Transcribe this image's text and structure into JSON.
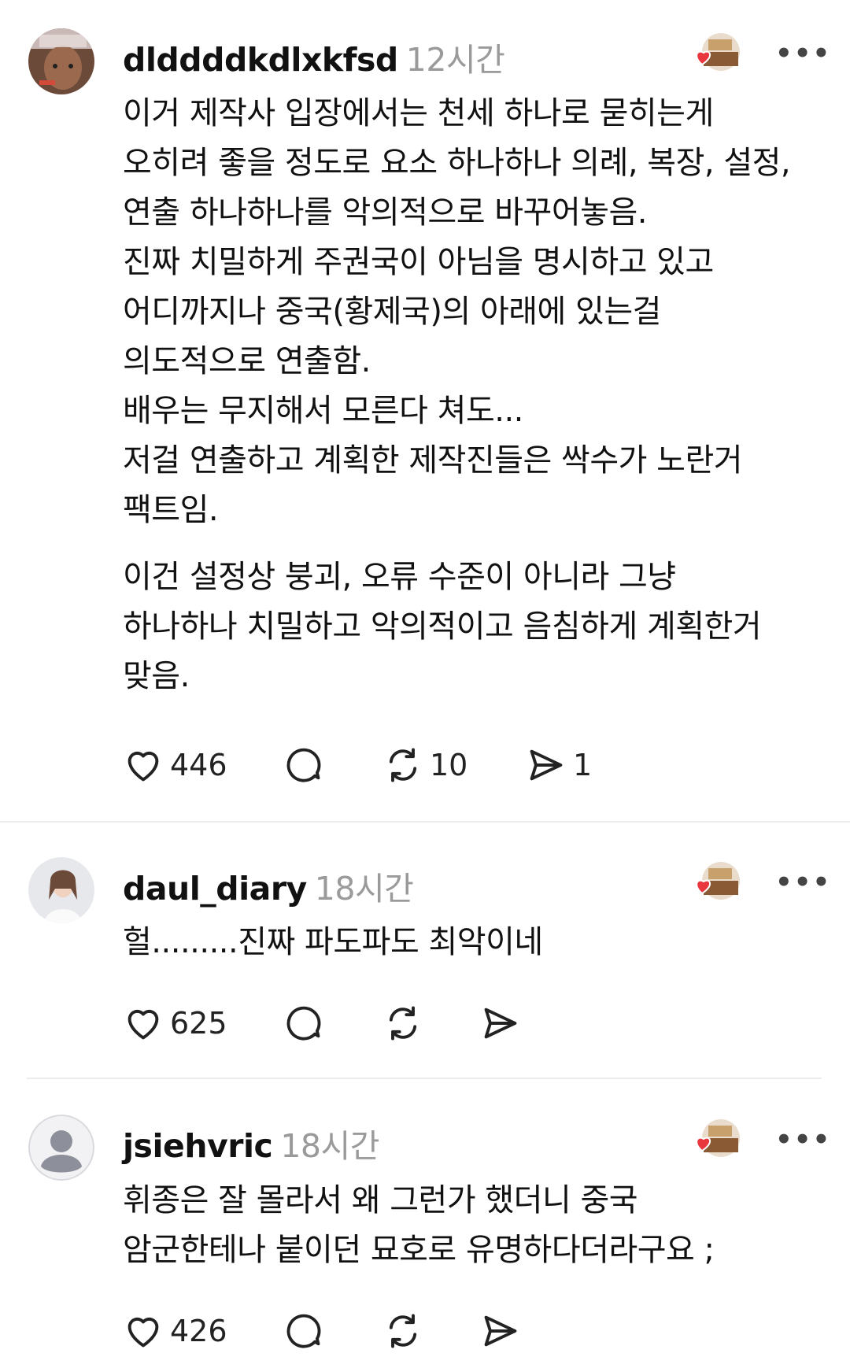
{
  "posts": [
    {
      "username": "dlddddkdlxkfsd",
      "time": "12시간",
      "avatar": "user-photo-avatar",
      "paragraphs": [
        [
          "이거 제작사 입장에서는 천세 하나로 묻히는게",
          "오히려 좋을 정도로 요소 하나하나 의례, 복장, 설정,",
          "연출 하나하나를 악의적으로 바꾸어놓음.",
          "진짜 치밀하게 주권국이 아님을 명시하고 있고",
          "어디까지나 중국(황제국)의 아래에 있는걸",
          "의도적으로 연출함.",
          "배우는 무지해서 모른다 쳐도...",
          "저걸 연출하고 계획한 제작진들은 싹수가 노란거",
          "팩트임."
        ],
        [
          "이건 설정상 붕괴, 오류 수준이 아니라 그냥",
          "하나하나 치밀하고 악의적이고 음침하게 계획한거",
          "맞음."
        ]
      ],
      "likes": "446",
      "comments": "",
      "reposts": "10",
      "shares": "1"
    },
    {
      "username": "daul_diary",
      "time": "18시간",
      "avatar": "user-photo-avatar",
      "paragraphs": [
        [
          "헐.........진짜 파도파도 최악이네"
        ]
      ],
      "likes": "625",
      "comments": "",
      "reposts": "",
      "shares": ""
    },
    {
      "username": "jsiehvric",
      "time": "18시간",
      "avatar": "default-person-avatar",
      "paragraphs": [
        [
          "휘종은 잘 몰라서 왜 그런가 했더니 중국",
          "암군한테나 붙이던 묘호로 유명하다더라구요 ;"
        ]
      ],
      "likes": "426",
      "comments": "",
      "reposts": "",
      "shares": ""
    }
  ],
  "more_label": "•••",
  "icons": {
    "like": "heart-icon",
    "comment": "comment-bubble-icon",
    "repost": "repost-icon",
    "share": "send-icon",
    "badge": "liked-by-author-badge"
  },
  "colors": {
    "heart_badge": "#e8383d",
    "time": "#9a9a9a",
    "divider": "#ececec"
  }
}
